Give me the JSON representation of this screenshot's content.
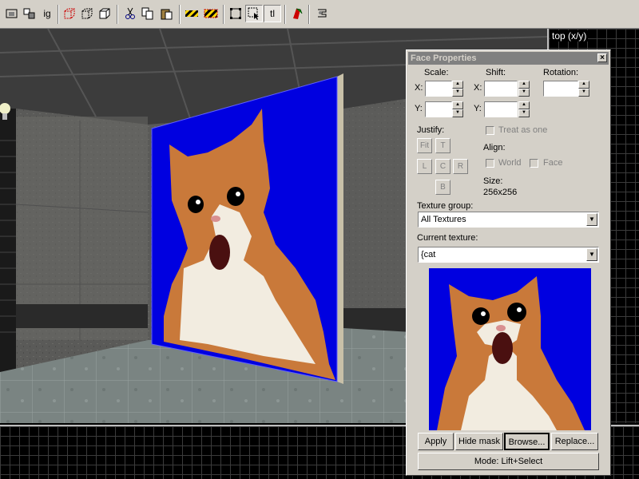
{
  "toolbar": {
    "ig_label": "ig",
    "tl_label": "tl",
    "buttons": [
      "screenshot-icon",
      "group-icon",
      "ignore-group-label",
      "red-box-icon",
      "box-outline-icon",
      "box-solid-icon",
      "cut-icon",
      "copy-icon",
      "paste-icon",
      "hazard-stripe-icon",
      "hazard-stripe-red-icon",
      "select-box-icon",
      "select-pointer-icon",
      "texture-lock-label",
      "carve-icon",
      "compile-icon"
    ]
  },
  "view2d": {
    "label": "top (x/y)"
  },
  "dialog": {
    "title": "Face Properties",
    "close": "×",
    "scale_label": "Scale:",
    "shift_label": "Shift:",
    "rotation_label": "Rotation:",
    "x_label": "X:",
    "y_label": "Y:",
    "justify_label": "Justify:",
    "justify_fit": "Fit",
    "justify_t": "T",
    "justify_l": "L",
    "justify_c": "C",
    "justify_r": "R",
    "justify_b": "B",
    "treat_as_one": "Treat as one",
    "align_label": "Align:",
    "world_label": "World",
    "face_label": "Face",
    "size_label": "Size:",
    "size_value": "256x256",
    "texture_group_label": "Texture group:",
    "texture_group_value": "All Textures",
    "current_texture_label": "Current texture:",
    "current_texture_value": "{cat",
    "apply": "Apply",
    "hide_mask": "Hide mask",
    "browse": "Browse...",
    "replace": "Replace...",
    "mode": "Mode: Lift+Select"
  },
  "colors": {
    "texture_blue": "#0000e0",
    "dialog_gray": "#d4d0c8"
  }
}
